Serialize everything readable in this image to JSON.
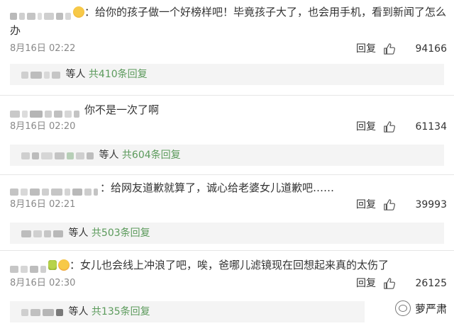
{
  "comments": [
    {
      "text_line1": "：给你的孩子做一个好榜样吧！毕竟孩子大了，也会用手机，看到新闻了怎么",
      "text_line2": "办",
      "time": "8月16日 02:22",
      "reply_label": "回复",
      "likes": "94166",
      "sub_suffix": "等人",
      "sub_count": "共410条回复"
    },
    {
      "text_line1": "你不是一次了啊",
      "time": "8月16日 02:20",
      "reply_label": "回复",
      "likes": "61134",
      "sub_suffix": "等人",
      "sub_count": "共604条回复"
    },
    {
      "text_line1": "：给网友道歉就算了，诚心给老婆女儿道歉吧……",
      "time": "8月16日 02:21",
      "reply_label": "回复",
      "likes": "39993",
      "sub_suffix": "等人",
      "sub_count": "共503条回复"
    },
    {
      "text_line1": "：女儿也会线上冲浪了吧，唉，爸哪儿滤镜现在回想起来真的太伤了",
      "time": "8月16日 02:30",
      "reply_label": "回复",
      "likes": "26125",
      "sub_suffix": "等人",
      "sub_count": "共135条回复"
    }
  ],
  "watermark": "萝严肃",
  "icons": {
    "like": "thumbs-up-icon",
    "watermark": "wechat-logo-icon",
    "emoji": "face-emoji-icon"
  },
  "colors": {
    "count_green": "#5b9a5b",
    "sub_bg": "#f4f4f4",
    "meta_gray": "#888888"
  }
}
